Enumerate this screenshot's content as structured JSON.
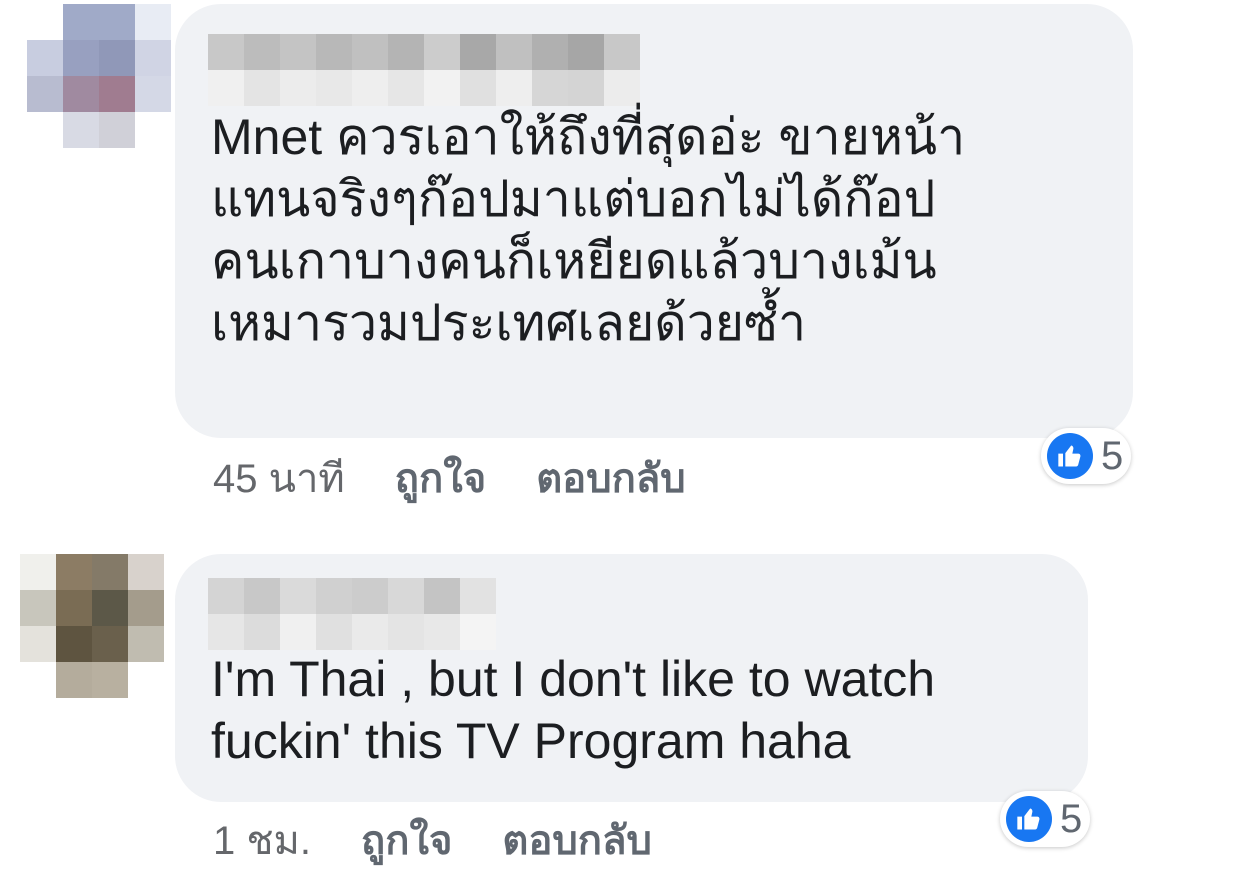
{
  "colors": {
    "bubble_bg": "#f0f2f5",
    "meta_text": "#606770",
    "like_blue": "#1877f2"
  },
  "comments": [
    {
      "text": "Mnet ควรเอาให้ถึงที่สุดอ่ะ ขายหน้า\nแทนจริงๆก๊อปมาแต่บอกไม่ได้ก๊อป\nคนเกาบางคนก็เหยียดแล้วบางเม้น\nเหมารวมประเทศเลยด้วยซ้ำ",
      "time": "45 นาที",
      "like_label": "ถูกใจ",
      "reply_label": "ตอบกลับ",
      "reaction_icon": "thumbs-up-icon",
      "reaction_count": "5",
      "avatar_pixels": [
        "#ffffff",
        "#a0aac8",
        "#a0aac8",
        "#e8ecf4",
        "#c8cde0",
        "#98a0c0",
        "#9098b8",
        "#d0d4e4",
        "#b8bcd0",
        "#a08aa0",
        "#a07c90",
        "#d4d8e6",
        "#ffffff",
        "#d8dae4",
        "#d0d0d8",
        "#ffffff"
      ],
      "name_pixels": [
        "#c8c8c8",
        "#f0f0f0",
        "#bcbcbc",
        "#e4e4e4",
        "#c4c4c4",
        "#ececec",
        "#b8b8b8",
        "#e8e8e8",
        "#c0c0c0",
        "#eeeeee",
        "#b4b4b4",
        "#e6e6e6",
        "#cccccc",
        "#f2f2f2",
        "#a8a8a8",
        "#e0e0e0",
        "#c0c0c0",
        "#eeeeee",
        "#b0b0b0",
        "#d6d6d6",
        "#a6a6a6",
        "#d4d4d4",
        "#c8c8c8",
        "#ececec"
      ]
    },
    {
      "text": "I'm Thai , but I don't like to watch\nfuckin' this TV Program haha",
      "time": "1 ชม.",
      "like_label": "ถูกใจ",
      "reply_label": "ตอบกลับ",
      "reaction_icon": "thumbs-up-icon",
      "reaction_count": "5",
      "avatar_pixels": [
        "#f0f0ec",
        "#8c7c64",
        "#847a68",
        "#d8d2cc",
        "#c8c6bc",
        "#7a6c54",
        "#5c5848",
        "#a49c8c",
        "#e4e2dc",
        "#5e5440",
        "#6a604c",
        "#c0bcb0",
        "#ffffff",
        "#b4ac9c",
        "#b8b0a0",
        "#ffffff"
      ],
      "name_pixels": [
        "#d4d4d4",
        "#e6e6e6",
        "#c8c8c8",
        "#dcdcdc",
        "#dadada",
        "#f0f0f0",
        "#d0d0d0",
        "#e0e0e0",
        "#cccccc",
        "#eaeaea",
        "#d8d8d8",
        "#e4e4e4",
        "#c4c4c4",
        "#e8e8e8",
        "#e2e2e2",
        "#f4f4f4"
      ]
    }
  ]
}
